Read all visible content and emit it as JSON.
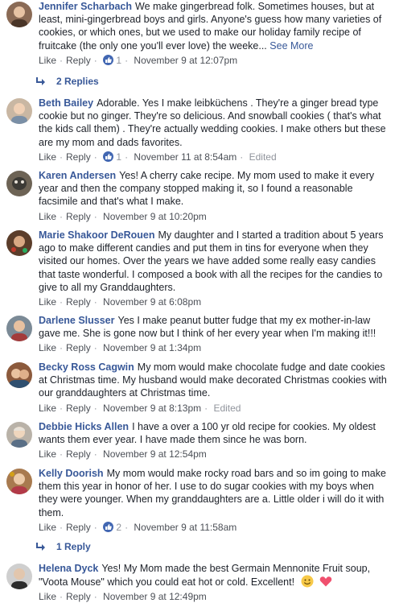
{
  "comments": [
    {
      "author": "Jennifer Scharbach",
      "text": "We make gingerbread folk. Sometimes houses, but at least, mini-gingerbread boys and girls. Anyone's guess how many varieties of cookies, or which ones, but we used to make our holiday family recipe of fruitcake (the only one you'll ever love) the weeke...",
      "see_more": "See More",
      "like": "Like",
      "reply": "Reply",
      "reaction_count": "1",
      "time": "November 9 at 12:07pm"
    },
    {
      "author": "Beth Bailey",
      "text": "Adorable. Yes I make leibküchens . They're a ginger bread type cookie but no ginger. They're so delicious. And snowball cookies ( that's what the kids call them) . They're actually wedding cookies. I make others but these are my mom and dads favorites.",
      "like": "Like",
      "reply": "Reply",
      "reaction_count": "1",
      "time": "November 11 at 8:54am",
      "edited": "Edited"
    },
    {
      "author": "Karen Andersen",
      "text": "Yes! A cherry cake recipe. My mom used to make it every year and then the company stopped making it, so I found a reasonable facsimile and that's what I make.",
      "like": "Like",
      "reply": "Reply",
      "time": "November 9 at 10:20pm"
    },
    {
      "author": "Marie Shakoor DeRouen",
      "text": "My daughter and I started a tradition about 5 years ago to make different candies and put them in tins for everyone when they visited our homes. Over the years we have added some really easy candies that taste wonderful. I composed a book with all the recipes for the candies to give to all my Granddaughters.",
      "like": "Like",
      "reply": "Reply",
      "time": "November 9 at 6:08pm"
    },
    {
      "author": "Darlene Slusser",
      "text": "Yes I make peanut butter fudge that my ex mother-in-law gave me. She is gone now but I think of her every year when I'm making it!!!",
      "like": "Like",
      "reply": "Reply",
      "time": "November 9 at 1:34pm"
    },
    {
      "author": "Becky Ross Cagwin",
      "text": "My mom would make chocolate fudge and date cookies at Christmas time. My husband would make decorated Christmas cookies with our granddaughters at Christmas time.",
      "like": "Like",
      "reply": "Reply",
      "time": "November 9 at 8:13pm",
      "edited": "Edited"
    },
    {
      "author": "Debbie Hicks Allen",
      "text": "I have a over a 100 yr old recipe for cookies. My oldest wants them ever year. I have made them since he was born.",
      "like": "Like",
      "reply": "Reply",
      "time": "November 9 at 12:54pm"
    },
    {
      "author": "Kelly Doorish",
      "text": "My mom would make rocky road bars and so im going to make them this year in honor of her. I use to do sugar cookies with my boys when they were younger. When my granddaughters are a. Little older i will do it with them.",
      "like": "Like",
      "reply": "Reply",
      "reaction_count": "2",
      "time": "November 9 at 11:58am"
    },
    {
      "author": "Helena Dyck",
      "text": "Yes! My Mom made the best Germain Mennonite Fruit soup, \"Voota Mouse\" which you could eat hot or cold. Excellent!",
      "like": "Like",
      "reply": "Reply",
      "time": "November 9 at 12:49pm"
    }
  ],
  "replies": [
    {
      "label": "2 Replies"
    },
    {
      "label": "1 Reply"
    }
  ],
  "colors": {
    "link": "#385898",
    "meta": "#90949c",
    "like_badge": "#4267b2"
  },
  "icons": [
    "avatar",
    "like-reaction-icon",
    "reply-arrow-icon",
    "smile-emoji-icon",
    "heart-emoji-icon"
  ]
}
